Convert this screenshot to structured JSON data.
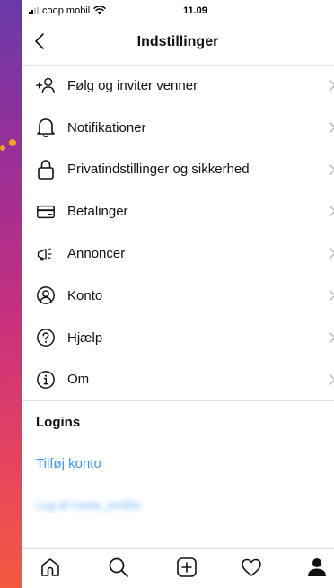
{
  "status_bar": {
    "carrier": "coop mobil",
    "time": "11.09"
  },
  "nav": {
    "title": "Indstillinger"
  },
  "menu": {
    "items": [
      {
        "label": "Følg og inviter venner",
        "icon": "add-person-icon"
      },
      {
        "label": "Notifikationer",
        "icon": "bell-icon"
      },
      {
        "label": "Privatindstillinger og sikkerhed",
        "icon": "lock-icon"
      },
      {
        "label": "Betalinger",
        "icon": "credit-card-icon"
      },
      {
        "label": "Annoncer",
        "icon": "megaphone-icon"
      },
      {
        "label": "Konto",
        "icon": "account-circle-icon"
      },
      {
        "label": "Hjælp",
        "icon": "help-icon"
      },
      {
        "label": "Om",
        "icon": "info-icon"
      }
    ]
  },
  "logins": {
    "heading": "Logins",
    "add_account": "Tilføj konto",
    "logout_blurred": "Log af maria_smiths"
  },
  "tab_bar": {
    "icons": [
      "home-icon",
      "search-icon",
      "new-post-icon",
      "heart-icon",
      "profile-icon"
    ]
  },
  "colors": {
    "link": "#3897f0",
    "text": "#111111",
    "divider": "#e3e3e3",
    "background_gradient": [
      "#6a3aa8",
      "#c8307c",
      "#f25a3e"
    ]
  }
}
